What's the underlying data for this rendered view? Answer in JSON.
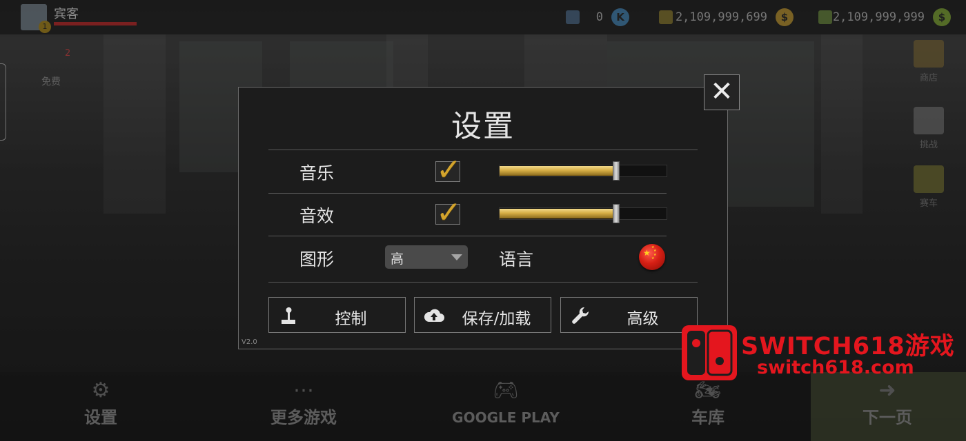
{
  "hud": {
    "player_name": "宾客",
    "level": "1",
    "currency_1": "0",
    "currency_2": "2,109,999,699",
    "currency_3": "2,109,999,999"
  },
  "side": {
    "left_label": "免费",
    "left_badge": "2",
    "right_items": [
      "商店",
      "挑战",
      "赛车"
    ]
  },
  "bottom_nav": {
    "settings": "设置",
    "more_games": "更多游戏",
    "google_play": "GOOGLE PLAY",
    "garage": "车库",
    "next": "下一页"
  },
  "dialog": {
    "title": "设置",
    "music_label": "音乐",
    "music_enabled": true,
    "music_volume": 0.7,
    "sfx_label": "音效",
    "sfx_enabled": true,
    "sfx_volume": 0.7,
    "graphics_label": "图形",
    "graphics_value": "高",
    "language_label": "语言",
    "language_flag_icon": "china-flag-icon",
    "btn_controls": "控制",
    "btn_save_load": "保存/加载",
    "btn_advanced": "高级",
    "version": "V2.0"
  },
  "watermark": {
    "line1": "SWITCH618游戏",
    "line2": "switch618.com"
  },
  "colors": {
    "accent_gold": "#d3a42c",
    "watermark_red": "#e4161e",
    "dialog_bg": "#1c1c1c"
  }
}
